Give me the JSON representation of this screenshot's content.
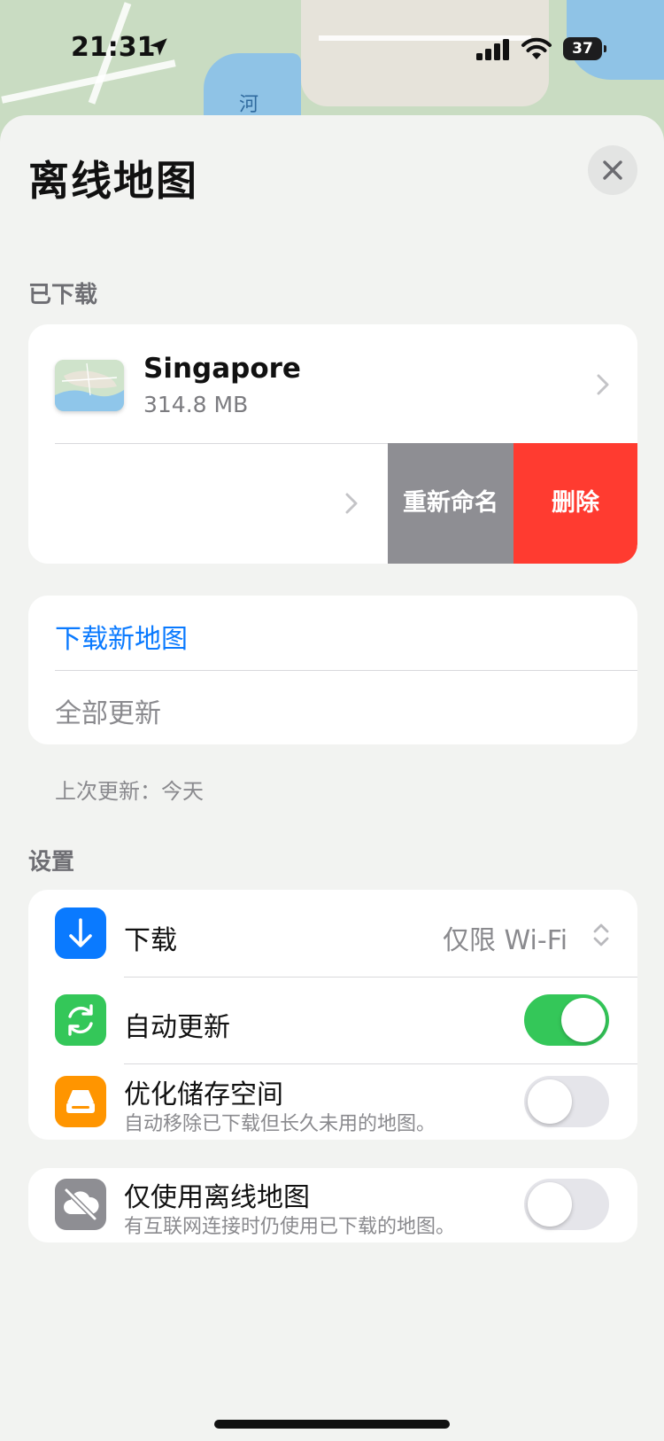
{
  "status_bar": {
    "time": "21:31",
    "battery": "37"
  },
  "map_label": "河",
  "header": {
    "title": "离线地图"
  },
  "downloaded": {
    "section_label": "已下载",
    "item": {
      "name": "Singapore",
      "size": "314.8 MB"
    },
    "swipe_actions": {
      "rename": "重新命名",
      "delete": "删除"
    }
  },
  "actions": {
    "download_new": "下载新地图",
    "update_all": "全部更新"
  },
  "last_update": "上次更新：今天",
  "settings": {
    "section_label": "设置",
    "download": {
      "label": "下载",
      "value": "仅限 Wi-Fi"
    },
    "auto_update": {
      "label": "自动更新",
      "enabled": true
    },
    "optimize_storage": {
      "label": "优化储存空间",
      "subtitle": "自动移除已下载但长久未用的地图。",
      "enabled": false
    },
    "offline_only": {
      "label": "仅使用离线地图",
      "subtitle": "有互联网连接时仍使用已下载的地图。",
      "enabled": false
    }
  },
  "colors": {
    "accent_blue": "#0a7aff",
    "delete_red": "#ff3b30",
    "rename_gray": "#8e8e93",
    "toggle_on": "#34c759",
    "download_tile": "#0a7aff",
    "auto_update_tile": "#34c759",
    "storage_tile": "#ff9500",
    "offline_tile": "#8e8e93"
  },
  "icons": {
    "location": "location-arrow-icon",
    "close": "close-icon",
    "chevron": "chevron-right-icon",
    "download": "arrow-down-icon",
    "auto_update": "refresh-icon",
    "storage": "drive-icon",
    "offline": "cloud-off-icon",
    "stepper": "chevron-up-down-icon"
  }
}
